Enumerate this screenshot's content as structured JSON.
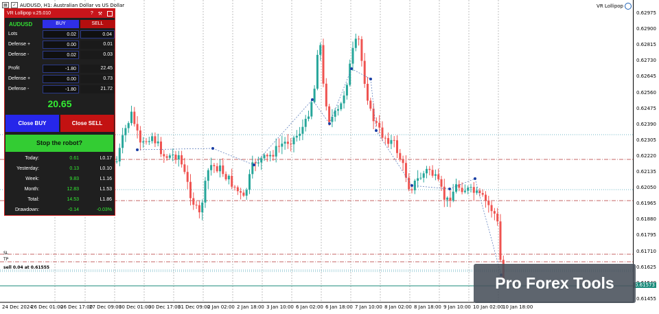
{
  "window": {
    "title": "AUDUSD, H1:  Australian Dollar vs US Dollar",
    "ea_label": "VR Lollipop"
  },
  "price_axis": {
    "ticks": [
      "0.62975",
      "0.62900",
      "0.62815",
      "0.62730",
      "0.62645",
      "0.62560",
      "0.62475",
      "0.62390",
      "0.62305",
      "0.62220",
      "0.62135",
      "0.62050",
      "0.61965",
      "0.61880",
      "0.61795",
      "0.61710",
      "0.61625",
      "0.61540",
      "0.61455"
    ],
    "current_price": "0.61573"
  },
  "time_axis": {
    "labels": [
      "24 Dec 2024",
      "26 Dec 01:00",
      "26 Dec 17:00",
      "27 Dec 09:00",
      "30 Dec 01:00",
      "30 Dec 17:00",
      "31 Dec 09:00",
      "2 Jan 02:00",
      "2 Jan 18:00",
      "3 Jan 10:00",
      "6 Jan 02:00",
      "6 Jan 18:00",
      "7 Jan 10:00",
      "8 Jan 02:00",
      "8 Jan 18:00",
      "9 Jan 10:00",
      "10 Jan 02:00",
      "10 Jan 18:00"
    ]
  },
  "levels": {
    "sl_label": "SL",
    "tp_label": "TP",
    "order_label": "sell 0.04 at 0.61555"
  },
  "panel": {
    "title": "VR Lollipop v.25.010",
    "help_icon": "?",
    "settings_icon": "⚒",
    "asset": "AUDUSD",
    "buy_header": "BUY",
    "sell_header": "SELL",
    "rows": [
      {
        "label": "Lots",
        "buy": "0.02",
        "sell": "0.04"
      },
      {
        "label": "Defense +",
        "buy": "0.00",
        "sell": "0.01"
      },
      {
        "label": "Defense -",
        "buy": "0.02",
        "sell": "0.03"
      },
      {
        "label": "Profit",
        "buy": "-1.80",
        "sell": "22.45"
      },
      {
        "label": "Defense +",
        "buy": "0.00",
        "sell": "0.73"
      },
      {
        "label": "Defense -",
        "buy": "-1.80",
        "sell": "21.72"
      }
    ],
    "total_profit": "20.65",
    "close_buy_label": "Close BUY",
    "close_sell_label": "Close SELL",
    "stop_label": "Stop the robot?",
    "stats": [
      {
        "label": "Today:",
        "profit": "0.61",
        "lots": "L0.17"
      },
      {
        "label": "Yesterday:",
        "profit": "0.13",
        "lots": "L0.10"
      },
      {
        "label": "Week:",
        "profit": "9.83",
        "lots": "L1.16"
      },
      {
        "label": "Month:",
        "profit": "12.83",
        "lots": "L1.53"
      },
      {
        "label": "Total:",
        "profit": "14.53",
        "lots": "L1.86"
      },
      {
        "label": "Drawdown:",
        "profit": "-0.14",
        "lots": "-0.03%"
      }
    ]
  },
  "watermark": "Pro Forex Tools",
  "colors": {
    "bull": "#26a69a",
    "bear": "#ef5350",
    "panel_red": "#c8151b",
    "panel_green": "#33cc33",
    "panel_blue": "#2626ea"
  }
}
